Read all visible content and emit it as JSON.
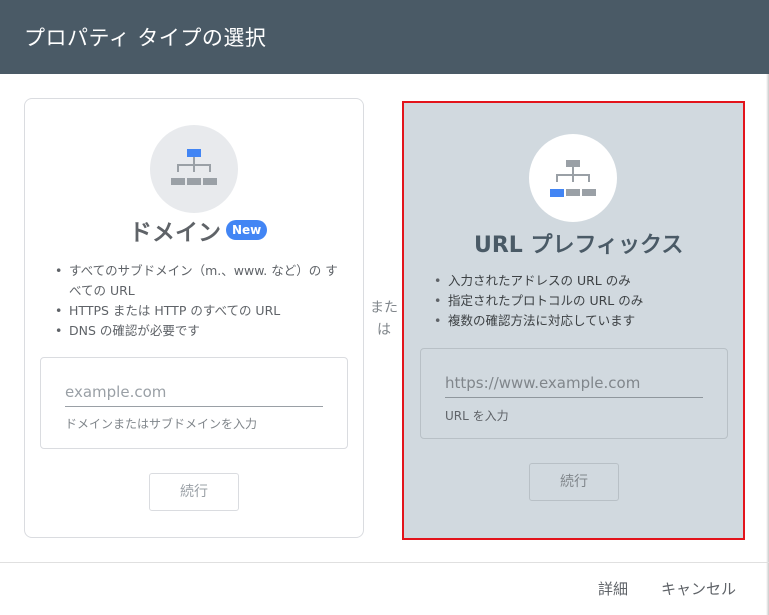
{
  "dialog": {
    "title": "プロパティ タイプの選択"
  },
  "domain_card": {
    "icon": "sitemap-icon",
    "title": "ドメイン",
    "badge": "New",
    "bullets": [
      "すべてのサブドメイン（m.、www. など）の すべての URL",
      "HTTPS または HTTP のすべての URL",
      "DNS の確認が必要です"
    ],
    "input": {
      "value": "",
      "placeholder": "example.com"
    },
    "helper": "ドメインまたはサブドメインを入力",
    "continue_label": "続行"
  },
  "separator": "または",
  "url_card": {
    "icon": "sitemap-icon",
    "title": "URL プレフィックス",
    "bullets": [
      "入力されたアドレスの URL のみ",
      "指定されたプロトコルの URL のみ",
      "複数の確認方法に対応しています"
    ],
    "input": {
      "value": "",
      "placeholder": "https://www.example.com"
    },
    "helper": "URL を入力",
    "continue_label": "続行"
  },
  "footer": {
    "details_label": "詳細",
    "cancel_label": "キャンセル"
  },
  "colors": {
    "header_bg": "#4a5a66",
    "accent_blue": "#4285f4",
    "selected_card_bg": "#d1d9df",
    "selection_border": "#e3141c"
  }
}
